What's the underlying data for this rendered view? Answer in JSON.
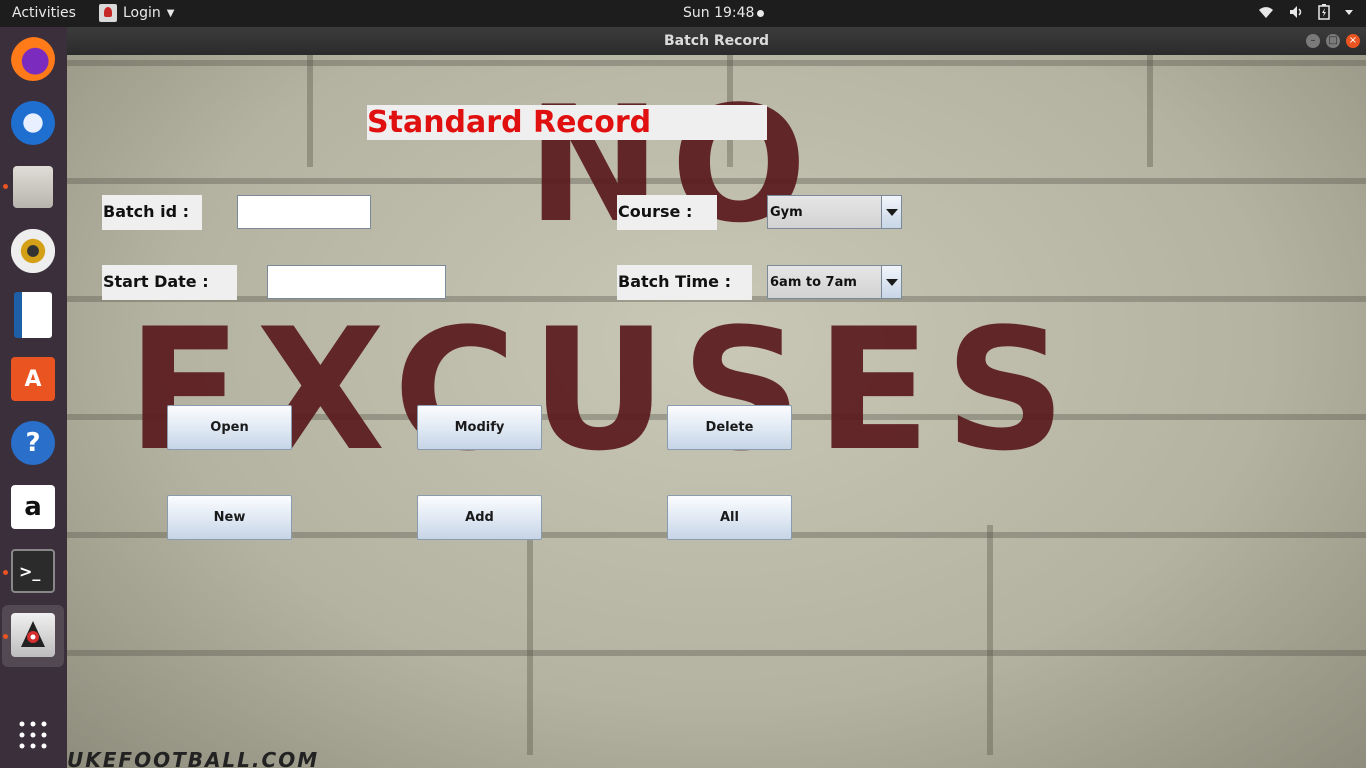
{
  "topbar": {
    "activities": "Activities",
    "app_name": "Login",
    "clock": "Sun 19:48"
  },
  "dock": {
    "items": [
      "firefox-icon",
      "thunderbird-icon",
      "files-icon",
      "rhythmbox-icon",
      "libreoffice-writer-icon",
      "software-center-icon",
      "help-icon",
      "amazon-icon",
      "terminal-icon",
      "java-app-icon"
    ],
    "show_apps": "show-applications-icon"
  },
  "window": {
    "title": "Batch  Record"
  },
  "form": {
    "heading": "Standard Record",
    "batch_id_label": "Batch id :",
    "batch_id_value": "",
    "start_date_label": "Start Date :",
    "start_date_value": "",
    "course_label": "Course :",
    "course_value": "Gym",
    "batch_time_label": "Batch Time :",
    "batch_time_value": "6am to 7am"
  },
  "buttons": {
    "open": "Open",
    "modify": "Modify",
    "delete": "Delete",
    "new": "New",
    "add": "Add",
    "all": "All"
  },
  "background": {
    "word_top": "NO",
    "word_main": "EXCUSES",
    "footer": "UKEFOOTBALL.COM"
  },
  "colors": {
    "heading_red": "#e01010",
    "stencil_red": "#5a1a1d",
    "ubuntu_orange": "#e95420"
  }
}
